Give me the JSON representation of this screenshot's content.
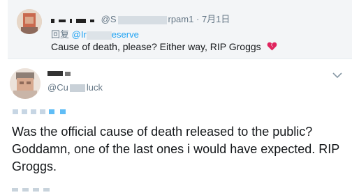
{
  "quoted_tweet": {
    "handle_prefix": "@S",
    "handle_suffix": "rpam1",
    "separator": "·",
    "date": "7月1日",
    "reply_prefix": "回复",
    "reply_mention_start": "@Ir",
    "reply_mention_end": "eserve",
    "text": "Cause of death, please? Either way, RIP Groggs",
    "emoji": "broken-heart-icon"
  },
  "main_tweet": {
    "handle_start": "@Cu",
    "handle_end": "luck",
    "text": "Was the official cause of death released to the public? Goddamn, one of the last ones i would have expected. RIP Groggs."
  },
  "colors": {
    "link": "#1da1f2",
    "muted": "#657786",
    "text": "#14171a",
    "quoted_bg": "#f3f5f7",
    "broken_heart": "#e0245e"
  }
}
